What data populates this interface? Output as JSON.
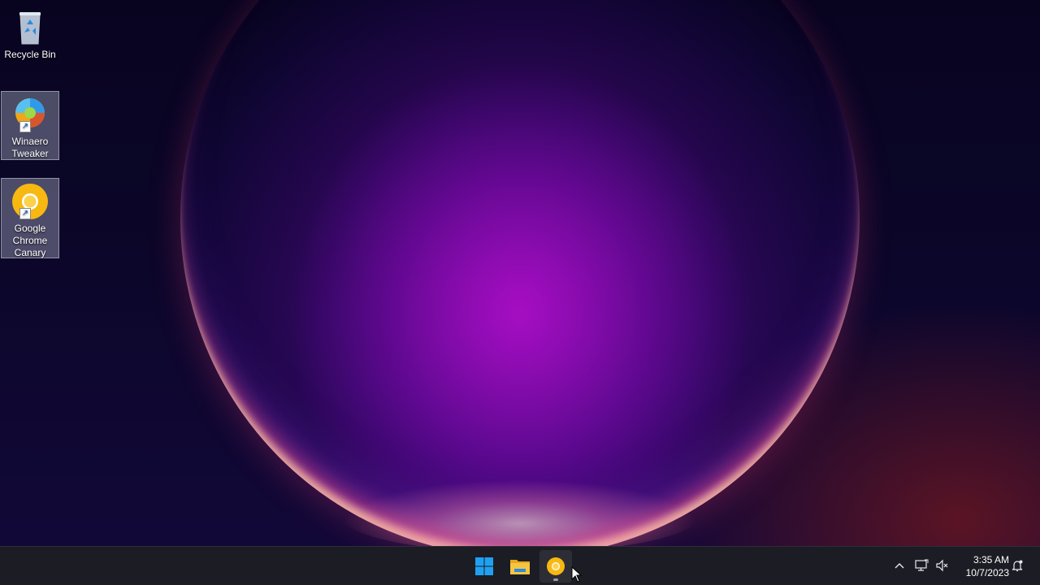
{
  "desktop": {
    "icons": [
      {
        "id": "recycle-bin",
        "label": "Recycle Bin"
      },
      {
        "id": "winaero-tweaker",
        "label": "Winaero Tweaker"
      },
      {
        "id": "chrome-canary",
        "label": "Google Chrome Canary"
      }
    ]
  },
  "taskbar": {
    "pinned": [
      {
        "name": "start-button",
        "icon": "windows-logo-icon"
      },
      {
        "name": "file-explorer-button",
        "icon": "folder-icon"
      },
      {
        "name": "chrome-canary-button",
        "icon": "chrome-canary-icon"
      }
    ],
    "tray": {
      "overflow_icon": "chevron-up-icon",
      "network_icon": "network-icon",
      "volume_icon": "volume-muted-icon",
      "notification_icon": "notification-icon"
    },
    "clock": {
      "time": "3:35 AM",
      "date": "10/7/2023"
    }
  },
  "colors": {
    "taskbar_bg": "#1c1c24",
    "windows_blue": "#1fa1f1",
    "folder_yellow": "#f5c542",
    "canary_yellow": "#f9c21a"
  }
}
